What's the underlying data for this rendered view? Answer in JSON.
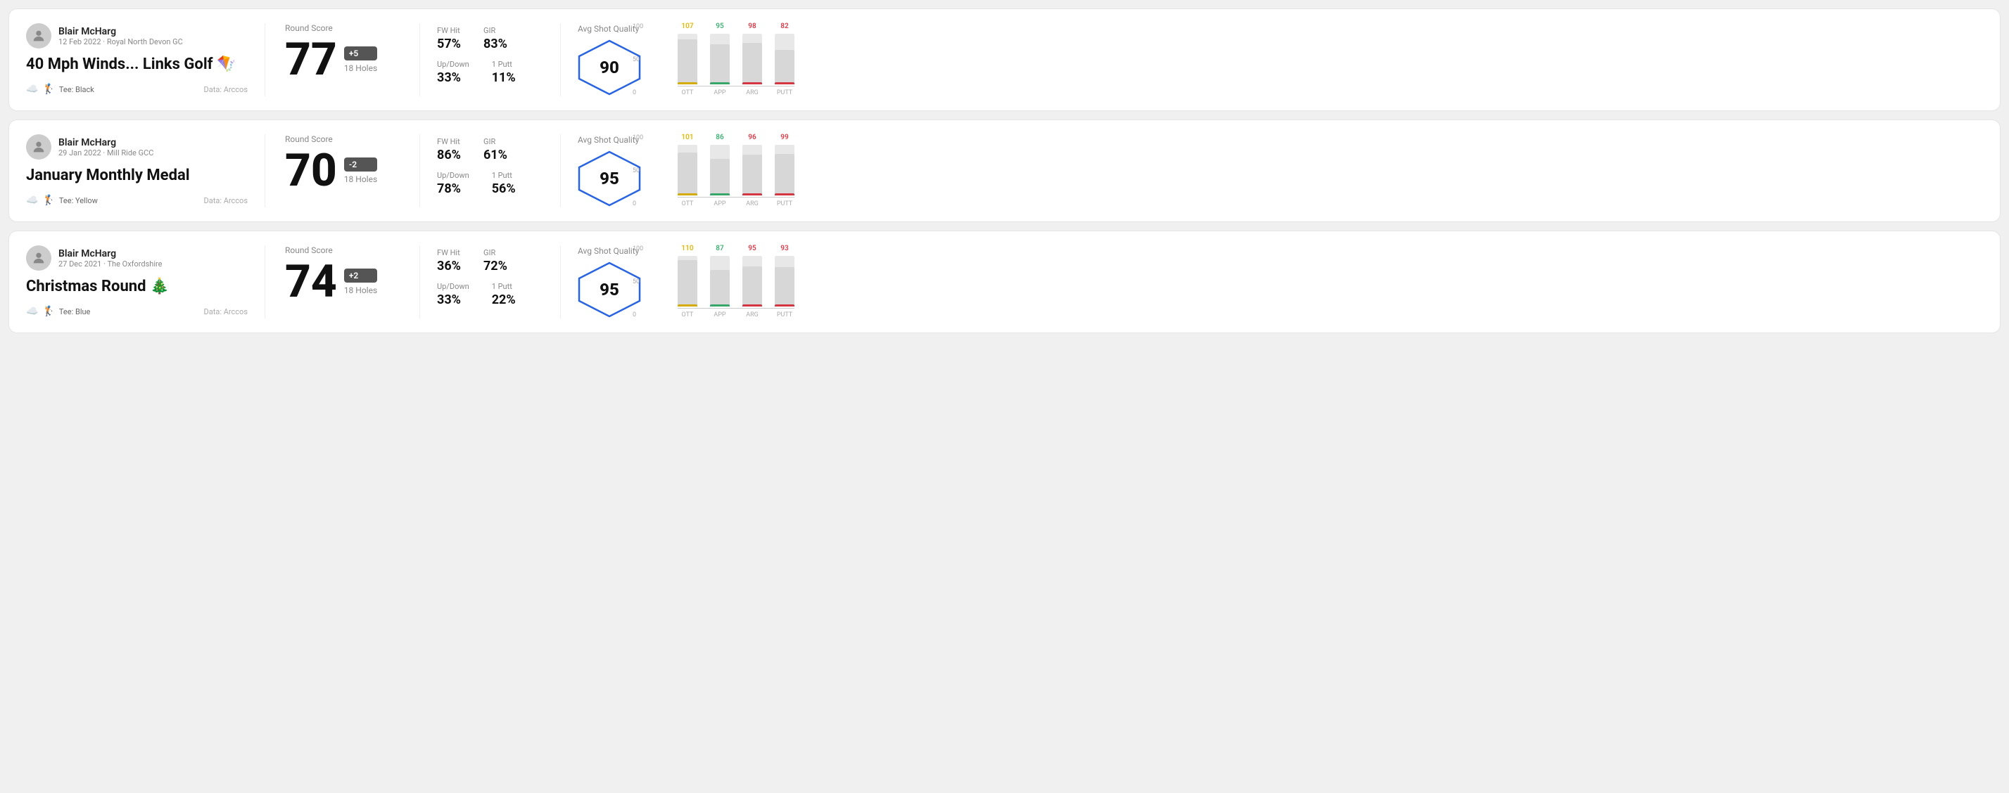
{
  "rounds": [
    {
      "id": "round1",
      "player": {
        "name": "Blair McHarg",
        "date": "12 Feb 2022",
        "course": "Royal North Devon GC"
      },
      "title": "40 Mph Winds... Links Golf 🪁",
      "tee": "Black",
      "dataSource": "Arccos",
      "score": {
        "value": "77",
        "badge": "+5",
        "badgeType": "over",
        "holes": "18 Holes"
      },
      "stats": {
        "fwHit": "57%",
        "gir": "83%",
        "upDown": "33%",
        "onePutt": "11%"
      },
      "quality": {
        "score": "90",
        "ott": {
          "value": 107,
          "color": "#e6b800"
        },
        "app": {
          "value": 95,
          "color": "#3cb371"
        },
        "arg": {
          "value": 98,
          "color": "#e63946"
        },
        "putt": {
          "value": 82,
          "color": "#e63946"
        }
      }
    },
    {
      "id": "round2",
      "player": {
        "name": "Blair McHarg",
        "date": "29 Jan 2022",
        "course": "Mill Ride GCC"
      },
      "title": "January Monthly Medal",
      "tee": "Yellow",
      "dataSource": "Arccos",
      "score": {
        "value": "70",
        "badge": "-2",
        "badgeType": "under",
        "holes": "18 Holes"
      },
      "stats": {
        "fwHit": "86%",
        "gir": "61%",
        "upDown": "78%",
        "onePutt": "56%"
      },
      "quality": {
        "score": "95",
        "ott": {
          "value": 101,
          "color": "#e6b800"
        },
        "app": {
          "value": 86,
          "color": "#3cb371"
        },
        "arg": {
          "value": 96,
          "color": "#e63946"
        },
        "putt": {
          "value": 99,
          "color": "#e63946"
        }
      }
    },
    {
      "id": "round3",
      "player": {
        "name": "Blair McHarg",
        "date": "27 Dec 2021",
        "course": "The Oxfordshire"
      },
      "title": "Christmas Round 🎄",
      "tee": "Blue",
      "dataSource": "Arccos",
      "score": {
        "value": "74",
        "badge": "+2",
        "badgeType": "over",
        "holes": "18 Holes"
      },
      "stats": {
        "fwHit": "36%",
        "gir": "72%",
        "upDown": "33%",
        "onePutt": "22%"
      },
      "quality": {
        "score": "95",
        "ott": {
          "value": 110,
          "color": "#e6b800"
        },
        "app": {
          "value": 87,
          "color": "#3cb371"
        },
        "arg": {
          "value": 95,
          "color": "#e63946"
        },
        "putt": {
          "value": 93,
          "color": "#e63946"
        }
      }
    }
  ],
  "labels": {
    "roundScore": "Round Score",
    "fwHit": "FW Hit",
    "gir": "GIR",
    "upDown": "Up/Down",
    "onePutt": "1 Putt",
    "avgShotQuality": "Avg Shot Quality",
    "ott": "OTT",
    "app": "APP",
    "arg": "ARG",
    "putt": "PUTT",
    "data": "Data:",
    "tee": "Tee:"
  }
}
